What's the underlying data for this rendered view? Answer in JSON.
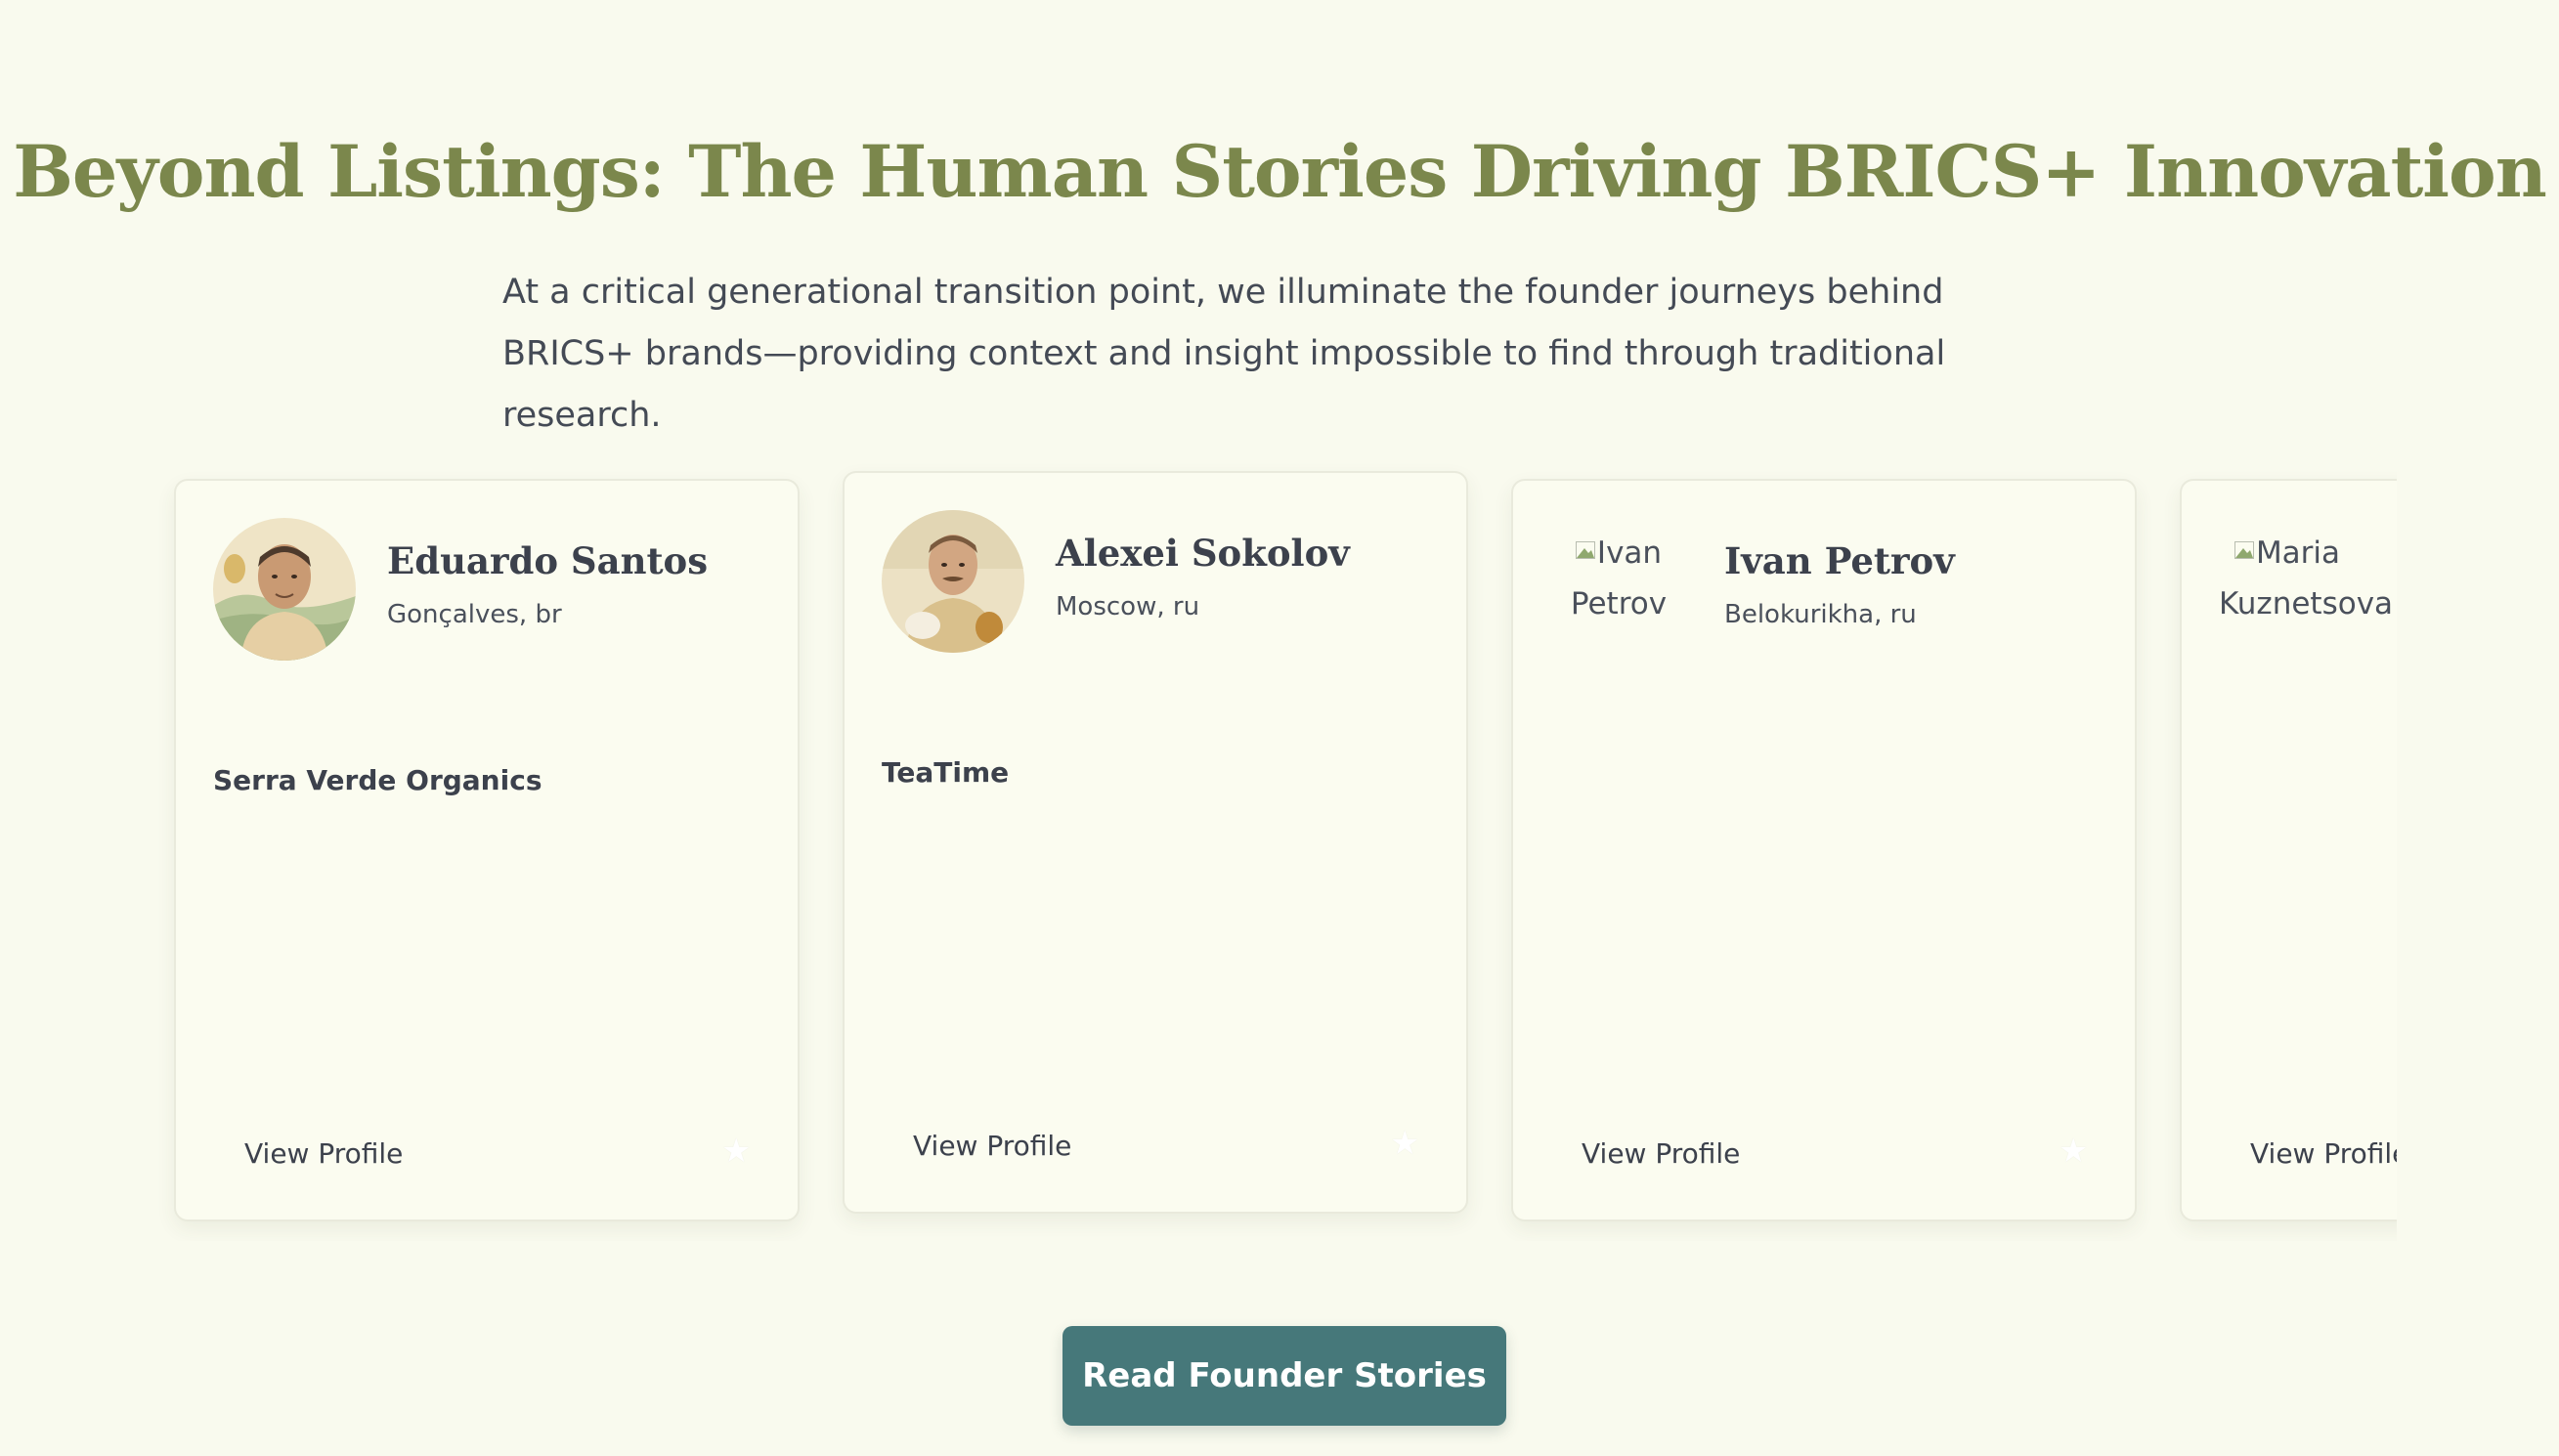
{
  "section": {
    "title": "Beyond Listings: The Human Stories Driving BRICS+ Innovation",
    "subtitle": "At a critical generational transition point, we illuminate the founder journeys behind BRICS+ brands—providing context and insight impossible to find through traditional research."
  },
  "founders": [
    {
      "name": "Eduardo Santos",
      "location": "Gonçalves, br",
      "brand": "Serra Verde Organics",
      "photo_alt": "Eduardo Santos",
      "photo_broken": false,
      "view_label": "View Profile",
      "favorite_icon": "star-icon"
    },
    {
      "name": "Alexei Sokolov",
      "location": "Moscow, ru",
      "brand": "TeaTime",
      "photo_alt": "Alexei Sokolov",
      "photo_broken": false,
      "view_label": "View Profile",
      "favorite_icon": "star-icon"
    },
    {
      "name": "Ivan Petrov",
      "location": "Belokurikha, ru",
      "brand": "",
      "photo_alt": "Ivan Petrov",
      "photo_broken": true,
      "view_label": "View Profile",
      "favorite_icon": "star-icon"
    },
    {
      "name": "",
      "location": "",
      "brand": "",
      "photo_alt": "Maria Kuznetsova",
      "photo_broken": true,
      "view_label": "View Profile",
      "favorite_icon": "star-icon"
    }
  ],
  "cta": {
    "label": "Read Founder Stories"
  },
  "colors": {
    "background": "#f9faee",
    "heading": "#7b874c",
    "cta_background": "#46787a",
    "cta_text": "#ffffff",
    "card_background": "#fbfcf0"
  }
}
